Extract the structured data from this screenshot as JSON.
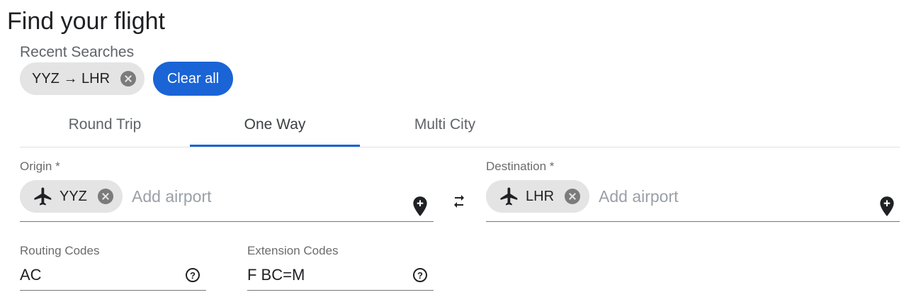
{
  "page": {
    "title": "Find your flight"
  },
  "recent": {
    "label": "Recent Searches",
    "items": [
      {
        "label": "YYZ → LHR"
      }
    ],
    "clear_all_label": "Clear all"
  },
  "tabs": [
    {
      "label": "Round Trip",
      "selected": false
    },
    {
      "label": "One Way",
      "selected": true
    },
    {
      "label": "Multi City",
      "selected": false
    }
  ],
  "origin": {
    "label": "Origin *",
    "chip": "YYZ",
    "placeholder": "Add airport",
    "chip_icon": "airplane-icon",
    "action_icon": "add-location-icon"
  },
  "swap": {
    "icon": "swap-icon"
  },
  "destination": {
    "label": "Destination *",
    "chip": "LHR",
    "placeholder": "Add airport",
    "chip_icon": "airplane-icon",
    "action_icon": "add-location-icon"
  },
  "routing": {
    "label": "Routing Codes",
    "value": "AC",
    "help_icon": "help-icon"
  },
  "extension": {
    "label": "Extension Codes",
    "value": "F BC=M",
    "help_icon": "help-icon"
  },
  "colors": {
    "accent": "#1a64d6",
    "chip_bg": "#e4e4e4",
    "text": "#202124",
    "muted": "#5f6368"
  }
}
